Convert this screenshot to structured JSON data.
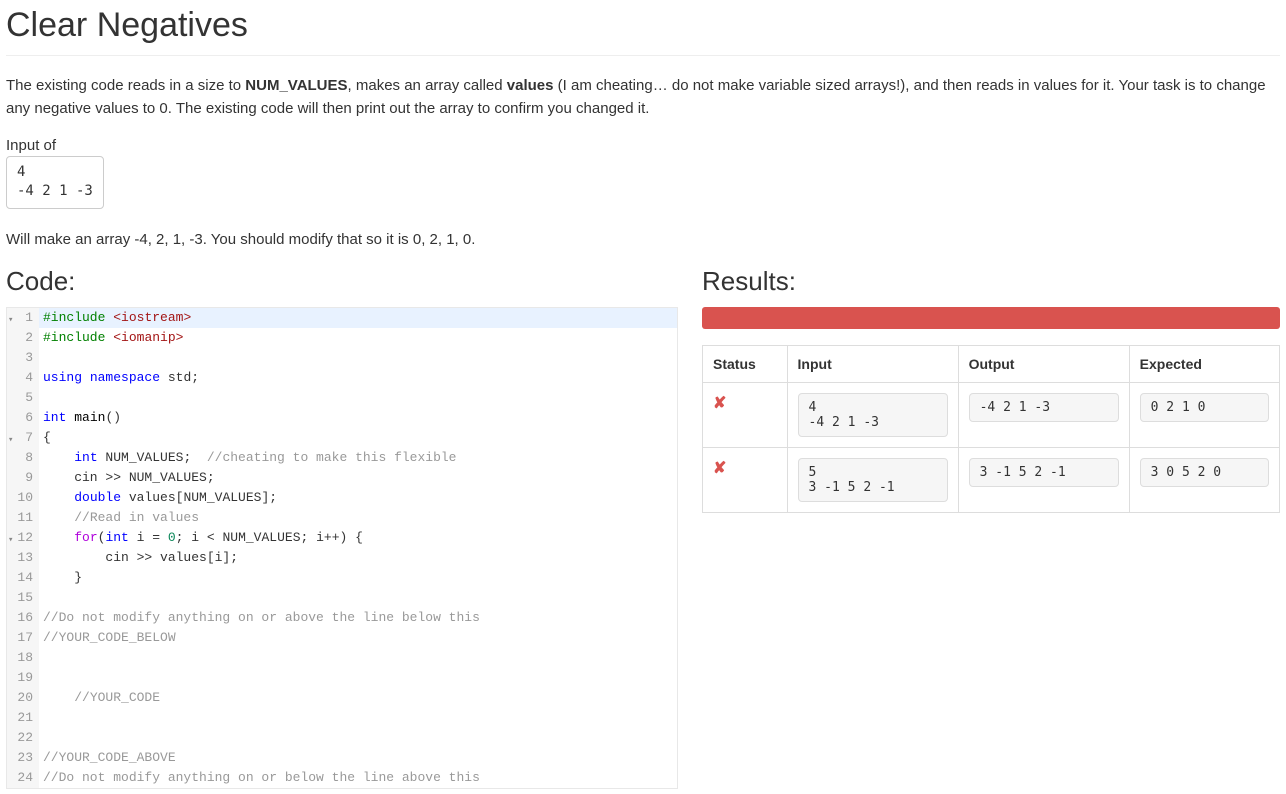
{
  "page": {
    "title": "Clear Negatives",
    "desc_prefix": "The existing code reads in a size to ",
    "desc_bold1": "NUM_VALUES",
    "desc_mid1": ", makes an array called ",
    "desc_bold2": "values",
    "desc_suffix": " (I am cheating… do not make variable sized arrays!), and then reads in values for it. Your task is to change any negative values to 0. The existing code will then print out the array to confirm you changed it.",
    "input_of_label": "Input of",
    "sample_input": "4\n-4 2 1 -3",
    "post_input_desc": "Will make an array -4, 2, 1, -3. You should modify that so it is 0, 2, 1, 0.",
    "code_heading": "Code:",
    "results_heading": "Results:"
  },
  "code": {
    "lines": [
      {
        "n": 1,
        "fold": true,
        "active": true,
        "t": [
          [
            "pp",
            "#include"
          ],
          [
            "",
            " "
          ],
          [
            "inc",
            "<iostream>"
          ]
        ]
      },
      {
        "n": 2,
        "t": [
          [
            "pp",
            "#include"
          ],
          [
            "",
            " "
          ],
          [
            "inc",
            "<iomanip>"
          ]
        ]
      },
      {
        "n": 3,
        "t": [
          [
            "",
            ""
          ]
        ]
      },
      {
        "n": 4,
        "t": [
          [
            "kw",
            "using"
          ],
          [
            "",
            " "
          ],
          [
            "kw",
            "namespace"
          ],
          [
            "",
            " std;"
          ]
        ]
      },
      {
        "n": 5,
        "t": [
          [
            "",
            ""
          ]
        ]
      },
      {
        "n": 6,
        "t": [
          [
            "type",
            "int"
          ],
          [
            "",
            " "
          ],
          [
            "fn",
            "main"
          ],
          [
            "",
            "()"
          ]
        ]
      },
      {
        "n": 7,
        "fold": true,
        "t": [
          [
            "",
            "{"
          ]
        ]
      },
      {
        "n": 8,
        "t": [
          [
            "",
            "    "
          ],
          [
            "type",
            "int"
          ],
          [
            "",
            " NUM_VALUES;  "
          ],
          [
            "cmt",
            "//cheating to make this flexible"
          ]
        ]
      },
      {
        "n": 9,
        "t": [
          [
            "",
            "    cin >> NUM_VALUES;"
          ]
        ]
      },
      {
        "n": 10,
        "t": [
          [
            "",
            "    "
          ],
          [
            "type",
            "double"
          ],
          [
            "",
            " values[NUM_VALUES];"
          ]
        ]
      },
      {
        "n": 11,
        "t": [
          [
            "",
            "    "
          ],
          [
            "cmt",
            "//Read in values"
          ]
        ]
      },
      {
        "n": 12,
        "fold": true,
        "t": [
          [
            "",
            "    "
          ],
          [
            "ctl",
            "for"
          ],
          [
            "",
            "("
          ],
          [
            "type",
            "int"
          ],
          [
            "",
            " i = "
          ],
          [
            "num",
            "0"
          ],
          [
            "",
            "; i < NUM_VALUES; i++) {"
          ]
        ]
      },
      {
        "n": 13,
        "t": [
          [
            "",
            "        cin >> values[i];"
          ]
        ]
      },
      {
        "n": 14,
        "t": [
          [
            "",
            "    }"
          ]
        ]
      },
      {
        "n": 15,
        "t": [
          [
            "",
            ""
          ]
        ]
      },
      {
        "n": 16,
        "t": [
          [
            "cmt",
            "//Do not modify anything on or above the line below this"
          ]
        ]
      },
      {
        "n": 17,
        "t": [
          [
            "cmt",
            "//YOUR_CODE_BELOW"
          ]
        ]
      },
      {
        "n": 18,
        "t": [
          [
            "",
            ""
          ]
        ]
      },
      {
        "n": 19,
        "t": [
          [
            "",
            ""
          ]
        ]
      },
      {
        "n": 20,
        "t": [
          [
            "",
            "    "
          ],
          [
            "cmt",
            "//YOUR_CODE"
          ]
        ]
      },
      {
        "n": 21,
        "t": [
          [
            "",
            ""
          ]
        ]
      },
      {
        "n": 22,
        "t": [
          [
            "",
            ""
          ]
        ]
      },
      {
        "n": 23,
        "t": [
          [
            "cmt",
            "//YOUR_CODE_ABOVE"
          ]
        ]
      },
      {
        "n": 24,
        "t": [
          [
            "cmt",
            "//Do not modify anything on or below the line above this"
          ]
        ]
      }
    ]
  },
  "results": {
    "status_color": "#d9534f",
    "headers": {
      "status": "Status",
      "input": "Input",
      "output": "Output",
      "expected": "Expected"
    },
    "rows": [
      {
        "pass": false,
        "input": "4\n-4 2 1 -3",
        "output": "-4 2 1 -3",
        "expected": "0 2 1 0"
      },
      {
        "pass": false,
        "input": "5\n3 -1 5 2 -1",
        "output": "3 -1 5 2 -1",
        "expected": "3 0 5 2 0"
      }
    ]
  }
}
